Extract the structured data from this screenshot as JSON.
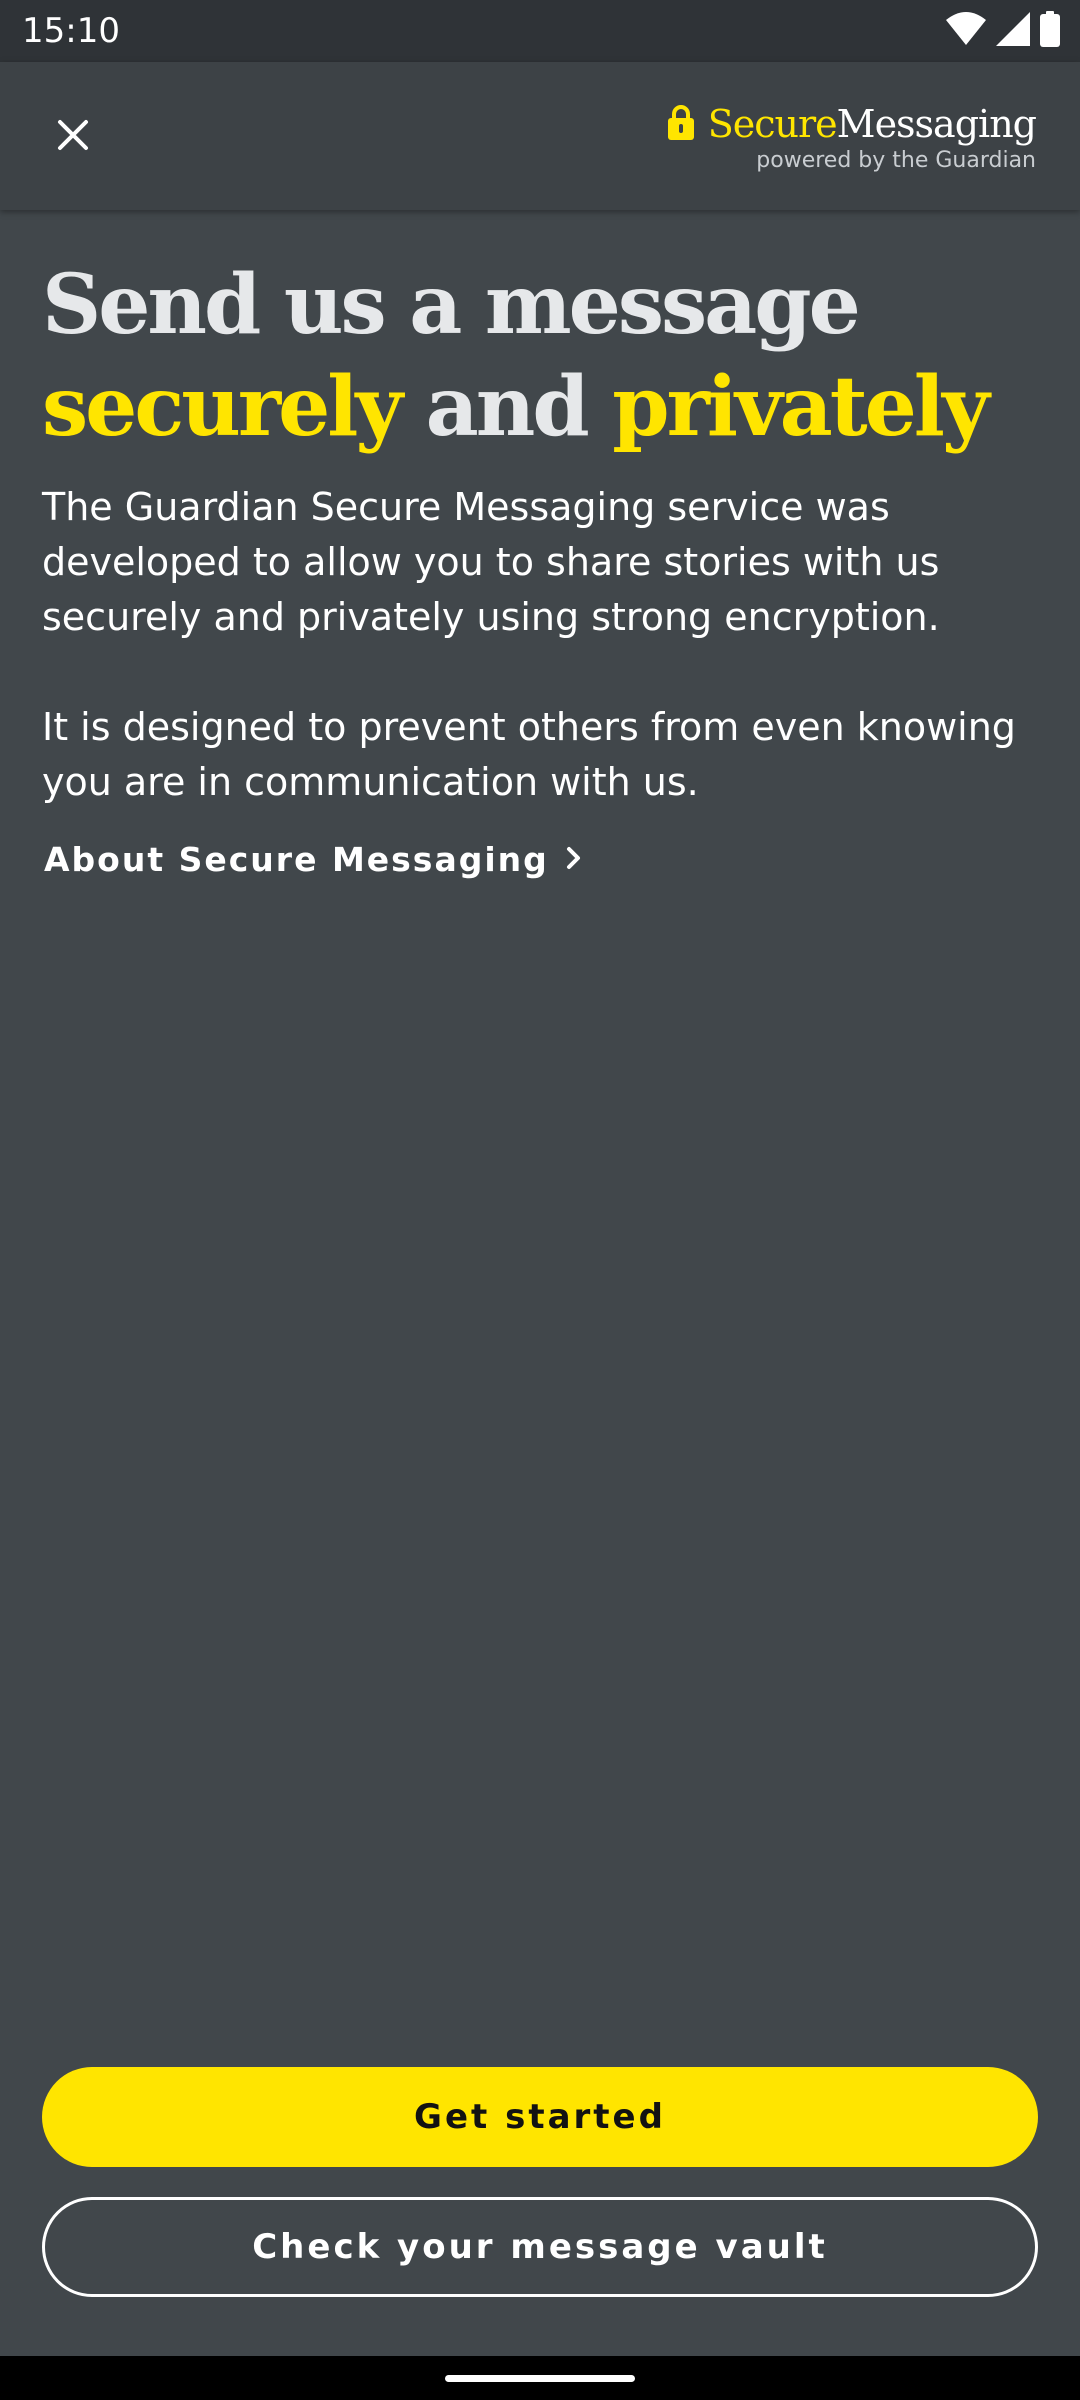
{
  "status_bar": {
    "time": "15:10",
    "icons": [
      "wifi-icon",
      "cellular-signal-icon",
      "battery-icon"
    ]
  },
  "header": {
    "close_icon": "close-icon",
    "brand": {
      "lock_icon": "lock-icon",
      "secure": "Secure",
      "messaging": "Messaging",
      "tagline": "powered by the Guardian"
    }
  },
  "main": {
    "headline": {
      "line1": "Send us a message",
      "word_securely": "securely",
      "word_and": "and",
      "word_privately": "privately"
    },
    "paragraph1": "The Guardian Secure Messaging service was developed to allow you to share stories with us securely and privately using strong encryption.",
    "paragraph2": "It is designed to prevent others from even knowing you are in communication with us.",
    "about_link": {
      "label": "About Secure Messaging",
      "icon": "chevron-right-icon"
    }
  },
  "actions": {
    "primary_label": "Get started",
    "secondary_label": "Check your message vault"
  },
  "colors": {
    "accent": "#ffe500",
    "background": "#41474b",
    "header_background": "#3d4246",
    "status_bar": "#2f3337"
  }
}
